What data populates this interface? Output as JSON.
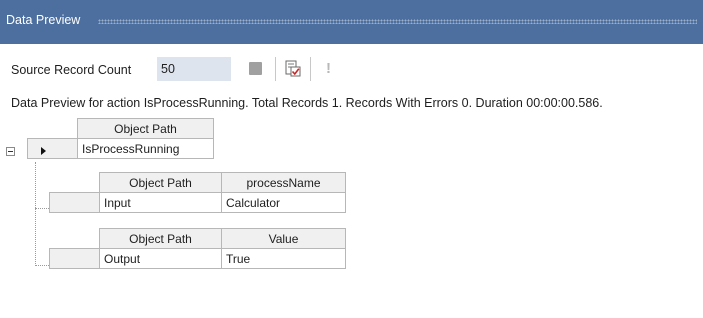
{
  "panel": {
    "title": "Data Preview"
  },
  "toolbar": {
    "source_record_count_label": "Source Record Count",
    "source_record_count_value": "50",
    "buttons": [
      {
        "name": "stop",
        "icon": "stop-icon"
      },
      {
        "name": "preview-document",
        "icon": "document-check-icon"
      },
      {
        "name": "exclamation",
        "icon": "exclamation-icon"
      }
    ]
  },
  "status": {
    "text": "Data Preview for action IsProcessRunning. Total Records 1. Records With Errors 0. Duration 00:00:00.586."
  },
  "root_grid": {
    "header": "Object Path",
    "row_value": "IsProcessRunning"
  },
  "input_grid": {
    "headers": [
      "Object Path",
      "processName"
    ],
    "row": [
      "Input",
      "Calculator"
    ]
  },
  "output_grid": {
    "headers": [
      "Object Path",
      "Value"
    ],
    "row": [
      "Output",
      "True"
    ]
  }
}
